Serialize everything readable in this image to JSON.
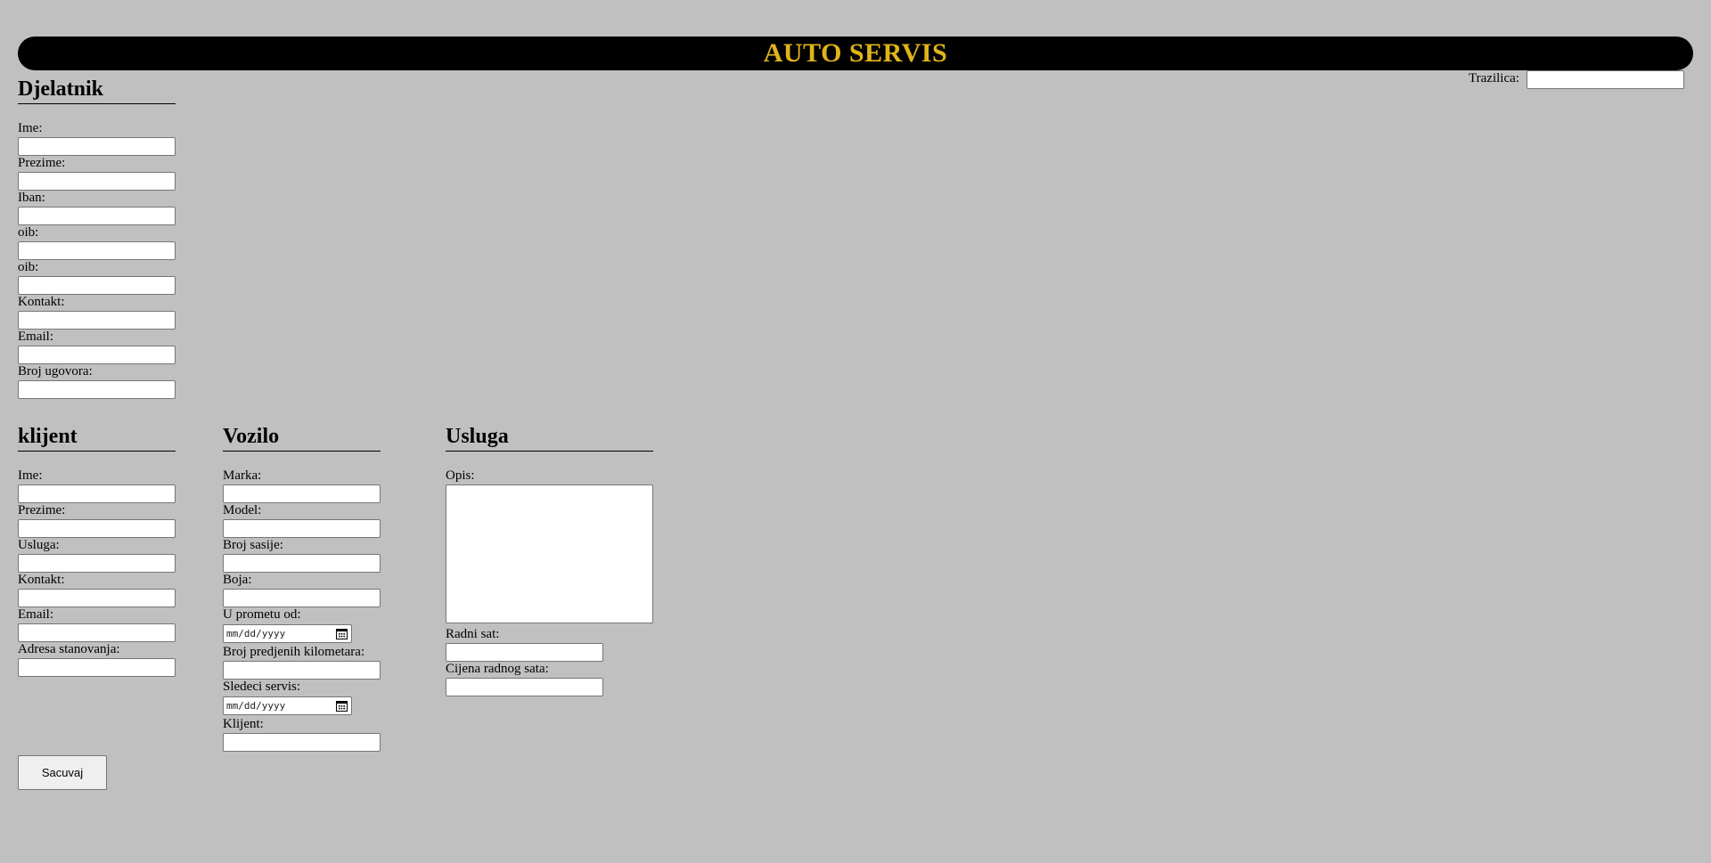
{
  "header": {
    "title": "AUTO SERVIS"
  },
  "search": {
    "label": "Trazilica:",
    "value": ""
  },
  "djelatnik": {
    "title": "Djelatnik",
    "fields": [
      {
        "label": "Ime:",
        "value": ""
      },
      {
        "label": "Prezime:",
        "value": ""
      },
      {
        "label": "Iban:",
        "value": ""
      },
      {
        "label": "oib:",
        "value": ""
      },
      {
        "label": "oib:",
        "value": ""
      },
      {
        "label": "Kontakt:",
        "value": ""
      },
      {
        "label": "Email:",
        "value": ""
      },
      {
        "label": "Broj ugovora:",
        "value": ""
      }
    ]
  },
  "klijent": {
    "title": "klijent",
    "fields": [
      {
        "label": "Ime:",
        "value": ""
      },
      {
        "label": "Prezime:",
        "value": ""
      },
      {
        "label": "Usluga:",
        "value": ""
      },
      {
        "label": "Kontakt:",
        "value": ""
      },
      {
        "label": "Email:",
        "value": ""
      },
      {
        "label": "Adresa stanovanja:",
        "value": ""
      }
    ]
  },
  "vozilo": {
    "title": "Vozilo",
    "fields": [
      {
        "label": "Marka:",
        "value": ""
      },
      {
        "label": "Model:",
        "value": ""
      },
      {
        "label": "Broj sasije:",
        "value": ""
      },
      {
        "label": "Boja:",
        "value": ""
      },
      {
        "label": "U prometu od:",
        "value": "",
        "placeholder": "mm/dd/yyyy"
      },
      {
        "label": "Broj predjenih kilometara:",
        "value": ""
      },
      {
        "label": "Sledeci servis:",
        "value": "",
        "placeholder": "mm/dd/yyyy"
      },
      {
        "label": "Klijent:",
        "value": ""
      }
    ]
  },
  "usluga": {
    "title": "Usluga",
    "fields": [
      {
        "label": "Opis:",
        "value": ""
      },
      {
        "label": "Radni sat:",
        "value": ""
      },
      {
        "label": "Cijena radnog sata:",
        "value": ""
      }
    ]
  },
  "actions": {
    "save_label": "Sacuvaj"
  },
  "colors": {
    "background": "#c0c0c0",
    "header_bg": "#000000",
    "header_text": "#e0b419"
  },
  "icons": {
    "date_picker": "calendar-icon"
  }
}
